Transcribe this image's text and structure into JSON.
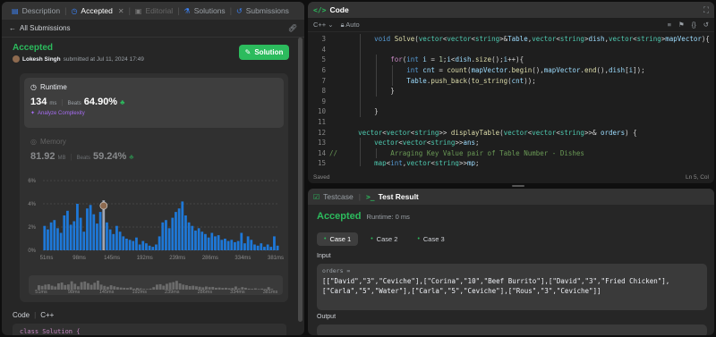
{
  "left_tabs": [
    {
      "label": "Description",
      "icon": "description-icon",
      "active": false
    },
    {
      "label": "Accepted",
      "icon": "clock-icon",
      "active": true,
      "closable": true
    },
    {
      "label": "Editorial",
      "icon": "lock-icon",
      "active": false
    },
    {
      "label": "Solutions",
      "icon": "flask-icon",
      "active": false
    },
    {
      "label": "Submissions",
      "icon": "history-icon",
      "active": false
    }
  ],
  "subbar": {
    "back_label": "All Submissions"
  },
  "submission": {
    "status": "Accepted",
    "author": "Lokesh Singh",
    "submitted_text": "submitted at Jul 11, 2024 17:49",
    "solution_button": "Solution"
  },
  "runtime": {
    "label": "Runtime",
    "value": "134",
    "unit": "ms",
    "beats_label": "Beats",
    "beats_value": "64.90%",
    "analyze_label": "Analyze Complexity"
  },
  "memory": {
    "label": "Memory",
    "value": "81.92",
    "unit": "MB",
    "beats_label": "Beats",
    "beats_value": "59.24%"
  },
  "chart_data": {
    "type": "bar",
    "title": "",
    "xlabel": "",
    "ylabel": "",
    "ylim": [
      0,
      6
    ],
    "y_ticks": [
      "6%",
      "4%",
      "2%",
      "0%"
    ],
    "x_ticks": [
      "51ms",
      "98ms",
      "145ms",
      "192ms",
      "239ms",
      "286ms",
      "334ms",
      "381ms"
    ],
    "highlight_value": "134ms",
    "values": [
      2.1,
      1.8,
      2.4,
      2.6,
      1.9,
      1.5,
      3.0,
      3.4,
      2.2,
      2.5,
      4.0,
      2.8,
      1.6,
      3.6,
      3.9,
      3.1,
      2.3,
      3.3,
      4.3,
      2.4,
      1.8,
      1.4,
      2.1,
      1.6,
      1.2,
      1.0,
      0.9,
      0.8,
      1.1,
      0.5,
      0.8,
      0.6,
      0.4,
      0.3,
      0.5,
      1.2,
      2.4,
      2.6,
      1.9,
      2.8,
      3.3,
      3.6,
      4.2,
      3.0,
      2.4,
      2.1,
      1.7,
      1.9,
      1.6,
      1.4,
      1.1,
      1.5,
      1.2,
      1.3,
      0.9,
      1.0,
      0.8,
      0.9,
      0.7,
      0.8,
      1.5,
      0.6,
      1.2,
      0.9,
      0.5,
      0.4,
      0.6,
      0.3,
      0.5,
      0.3,
      1.2,
      0.4
    ],
    "highlight_index": 18
  },
  "mini_chart": {
    "x_ticks": [
      "51ms",
      "98ms",
      "145ms",
      "192ms",
      "239ms",
      "286ms",
      "334ms",
      "381ms"
    ]
  },
  "code_section": {
    "label": "Code",
    "language": "C++",
    "preview_line": "class Solution {"
  },
  "editor": {
    "title": "Code",
    "language": "C++",
    "mode": "Auto",
    "status_left": "Saved",
    "status_right": "Ln 5, Col",
    "lines": [
      {
        "n": "3",
        "gutter": "",
        "indent": 2,
        "html_tokens": [
          [
            "kw",
            "void"
          ],
          [
            "",
            ""
          ],
          [
            "fn",
            " Solve"
          ],
          [
            "",
            "("
          ],
          [
            "ty",
            "vector"
          ],
          [
            "",
            "<"
          ],
          [
            "ty",
            "vector"
          ],
          [
            "",
            "<"
          ],
          [
            "ty",
            "string"
          ],
          [
            "",
            ">&"
          ],
          [
            "pm",
            "Table"
          ],
          [
            "",
            ","
          ],
          [
            "ty",
            "vector"
          ],
          [
            "",
            "<"
          ],
          [
            "ty",
            "string"
          ],
          [
            "",
            ">"
          ],
          [
            "pm",
            "dish"
          ],
          [
            "",
            ","
          ],
          [
            "ty",
            "vector"
          ],
          [
            "",
            "<"
          ],
          [
            "ty",
            "string"
          ],
          [
            "",
            ">"
          ],
          [
            "pm",
            "mapVector"
          ],
          [
            "",
            ")"
          ],
          [
            "",
            "{"
          ]
        ]
      },
      {
        "n": "4",
        "gutter": "",
        "indent": 2,
        "html_tokens": []
      },
      {
        "n": "5",
        "gutter": "",
        "indent": 3,
        "html_tokens": [
          [
            "ctl",
            "for"
          ],
          [
            "",
            "("
          ],
          [
            "kw",
            "int"
          ],
          [
            "pm",
            " i"
          ],
          [
            "",
            " = "
          ],
          [
            "nm",
            "1"
          ],
          [
            "",
            ";"
          ],
          [
            "pm",
            "i"
          ],
          [
            "",
            "<"
          ],
          [
            "pm",
            "dish"
          ],
          [
            "",
            "."
          ],
          [
            "fn",
            "size"
          ],
          [
            "",
            "();"
          ],
          [
            "pm",
            "i"
          ],
          [
            "",
            "++){"
          ]
        ]
      },
      {
        "n": "6",
        "gutter": "",
        "indent": 4,
        "html_tokens": [
          [
            "kw",
            "int"
          ],
          [
            "pm",
            " cnt"
          ],
          [
            "",
            " = "
          ],
          [
            "fn",
            "count"
          ],
          [
            "",
            "("
          ],
          [
            "pm",
            "mapVector"
          ],
          [
            "",
            "."
          ],
          [
            "fn",
            "begin"
          ],
          [
            "",
            "(),"
          ],
          [
            "pm",
            "mapVector"
          ],
          [
            "",
            "."
          ],
          [
            "fn",
            "end"
          ],
          [
            "",
            "(),"
          ],
          [
            "pm",
            "dish"
          ],
          [
            "",
            "["
          ],
          [
            "pm",
            "i"
          ],
          [
            "",
            "]);"
          ]
        ]
      },
      {
        "n": "7",
        "gutter": "",
        "indent": 4,
        "html_tokens": [
          [
            "pm",
            "Table"
          ],
          [
            "",
            "."
          ],
          [
            "fn",
            "push_back"
          ],
          [
            "",
            "("
          ],
          [
            "fn",
            "to_string"
          ],
          [
            "",
            "("
          ],
          [
            "pm",
            "cnt"
          ],
          [
            "",
            "));"
          ]
        ]
      },
      {
        "n": "8",
        "gutter": "",
        "indent": 3,
        "html_tokens": [
          [
            "",
            "}"
          ]
        ]
      },
      {
        "n": "9",
        "gutter": "",
        "indent": 2,
        "html_tokens": []
      },
      {
        "n": "10",
        "gutter": "",
        "indent": 2,
        "html_tokens": [
          [
            "",
            "}"
          ]
        ]
      },
      {
        "n": "11",
        "gutter": "",
        "indent": 1,
        "html_tokens": []
      },
      {
        "n": "12",
        "gutter": "",
        "indent": 1,
        "html_tokens": [
          [
            "ty",
            "vector"
          ],
          [
            "",
            "<"
          ],
          [
            "ty",
            "vector"
          ],
          [
            "",
            "<"
          ],
          [
            "ty",
            "string"
          ],
          [
            "",
            ">> "
          ],
          [
            "fn",
            "displayTable"
          ],
          [
            "",
            "("
          ],
          [
            "ty",
            "vector"
          ],
          [
            "",
            "<"
          ],
          [
            "ty",
            "vector"
          ],
          [
            "",
            "<"
          ],
          [
            "ty",
            "string"
          ],
          [
            "",
            ">>& "
          ],
          [
            "pm",
            "orders"
          ],
          [
            "",
            ") {"
          ]
        ]
      },
      {
        "n": "13",
        "gutter": "",
        "indent": 2,
        "html_tokens": [
          [
            "ty",
            "vector"
          ],
          [
            "",
            "<"
          ],
          [
            "ty",
            "vector"
          ],
          [
            "",
            "<"
          ],
          [
            "ty",
            "string"
          ],
          [
            "",
            ">>"
          ],
          [
            "pm",
            "ans"
          ],
          [
            "",
            ";"
          ]
        ]
      },
      {
        "n": "14",
        "gutter": "//",
        "indent": 3,
        "html_tokens": [
          [
            "cmt",
            "Arraging Key Value pair of Table Number - Dishes"
          ]
        ]
      },
      {
        "n": "15",
        "gutter": "",
        "indent": 2,
        "html_tokens": [
          [
            "ty",
            "map"
          ],
          [
            "",
            "<"
          ],
          [
            "kw",
            "int"
          ],
          [
            "",
            ","
          ],
          [
            "ty",
            "vector"
          ],
          [
            "",
            "<"
          ],
          [
            "ty",
            "string"
          ],
          [
            "",
            ">>"
          ],
          [
            "pm",
            "mp"
          ],
          [
            "",
            ";"
          ]
        ]
      }
    ]
  },
  "test_tabs": [
    {
      "label": "Testcase",
      "active": false
    },
    {
      "label": "Test Result",
      "active": true
    }
  ],
  "result": {
    "status": "Accepted",
    "runtime_text": "Runtime: 0 ms",
    "cases": [
      "Case 1",
      "Case 2",
      "Case 3"
    ],
    "input_label": "Input",
    "input_name": "orders =",
    "input_value": "[[\"David\",\"3\",\"Ceviche\"],[\"Corina\",\"10\",\"Beef Burrito\"],[\"David\",\"3\",\"Fried Chicken\"],[\"Carla\",\"5\",\"Water\"],[\"Carla\",\"5\",\"Ceviche\"],[\"Rous\",\"3\",\"Ceviche\"]]",
    "output_label": "Output"
  },
  "colors": {
    "accent_green": "#2cbb5d",
    "bar_blue": "#1e78d8",
    "bar_highlight": "#a0a6b4",
    "panel_bg": "#262626",
    "purple": "#a66cf2"
  }
}
